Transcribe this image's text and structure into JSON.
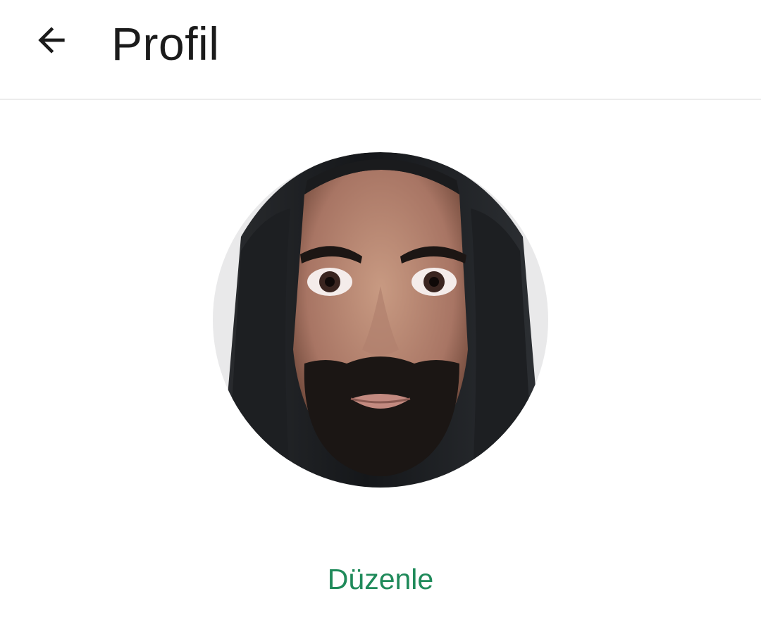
{
  "header": {
    "title": "Profil",
    "back_icon": "arrow-left-icon"
  },
  "profile": {
    "avatar_icon": "profile-photo"
  },
  "actions": {
    "edit_label": "Düzenle"
  },
  "colors": {
    "accent": "#1f8a5a",
    "title_text": "#1b1b1b",
    "divider": "#ececec"
  }
}
